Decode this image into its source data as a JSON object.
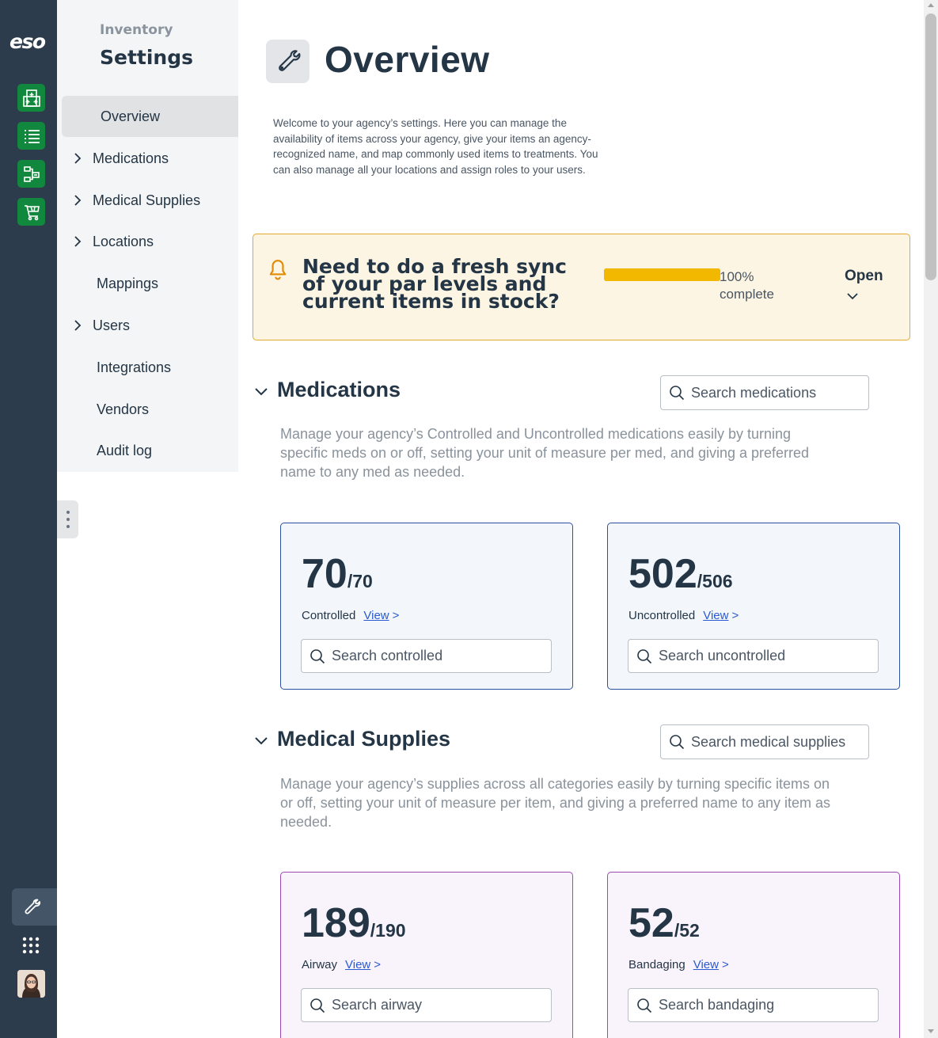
{
  "rail": {
    "logo": "eso",
    "items": [
      {
        "icon": "hospital-grid-icon"
      },
      {
        "icon": "list-icon"
      },
      {
        "icon": "workflow-icon"
      },
      {
        "icon": "cart-icon"
      }
    ],
    "active_icon": "wrench-icon",
    "apps_icon": "apps-grid-icon",
    "avatar_icon": "user-avatar"
  },
  "nav": {
    "eyebrow": "Inventory",
    "title": "Settings",
    "items": [
      {
        "label": "Overview",
        "active": true,
        "expandable": false
      },
      {
        "label": "Medications",
        "active": false,
        "expandable": true
      },
      {
        "label": "Medical Supplies",
        "active": false,
        "expandable": true
      },
      {
        "label": "Locations",
        "active": false,
        "expandable": true
      },
      {
        "label": "Mappings",
        "active": false,
        "expandable": false
      },
      {
        "label": "Users",
        "active": false,
        "expandable": true
      },
      {
        "label": "Integrations",
        "active": false,
        "expandable": false
      },
      {
        "label": "Vendors",
        "active": false,
        "expandable": false
      },
      {
        "label": "Audit log",
        "active": false,
        "expandable": false
      }
    ]
  },
  "page": {
    "title": "Overview",
    "description": "Welcome to your agency’s settings. Here you can manage the availability of items across your agency, give your items an agency-recognized name, and map commonly used items to treatments. You can also manage all your locations and assign roles to your users."
  },
  "banner": {
    "text": "Need to do a fresh sync of your par levels and current items in stock?",
    "progress": 100,
    "progress_label": "100% complete",
    "open_label": "Open"
  },
  "medications": {
    "title": "Medications",
    "search_placeholder": "Search medications",
    "description": "Manage your agency’s Controlled and Uncontrolled medications easily by turning specific meds on or off, setting your unit of measure per med, and giving a preferred name to any med as needed.",
    "cards": [
      {
        "count": "70",
        "total": "/70",
        "label": "Controlled",
        "link": "View",
        "arrow": ">",
        "search_placeholder": "Search controlled"
      },
      {
        "count": "502",
        "total": "/506",
        "label": "Uncontrolled",
        "link": "View",
        "arrow": ">",
        "search_placeholder": "Search uncontrolled"
      }
    ]
  },
  "supplies": {
    "title": "Medical Supplies",
    "search_placeholder": "Search medical supplies",
    "description": "Manage your agency’s supplies across all categories easily by turning specific items on or off, setting your unit of measure per item, and giving a preferred name to any item as needed.",
    "cards": [
      {
        "count": "189",
        "total": "/190",
        "label": "Airway",
        "link": "View",
        "arrow": ">",
        "search_placeholder": "Search airway"
      },
      {
        "count": "52",
        "total": "/52",
        "label": "Bandaging",
        "link": "View",
        "arrow": ">",
        "search_placeholder": "Search bandaging"
      }
    ]
  },
  "colors": {
    "rail_bg": "#2c3c4c",
    "rail_icon_bg": "#12883e",
    "banner_bg": "#fdf5e3",
    "banner_border": "#e3a82f",
    "progress": "#f2b800",
    "med_card_border": "#2c4fa3",
    "supply_card_border": "#9c49b5",
    "link": "#2a5ad2"
  }
}
